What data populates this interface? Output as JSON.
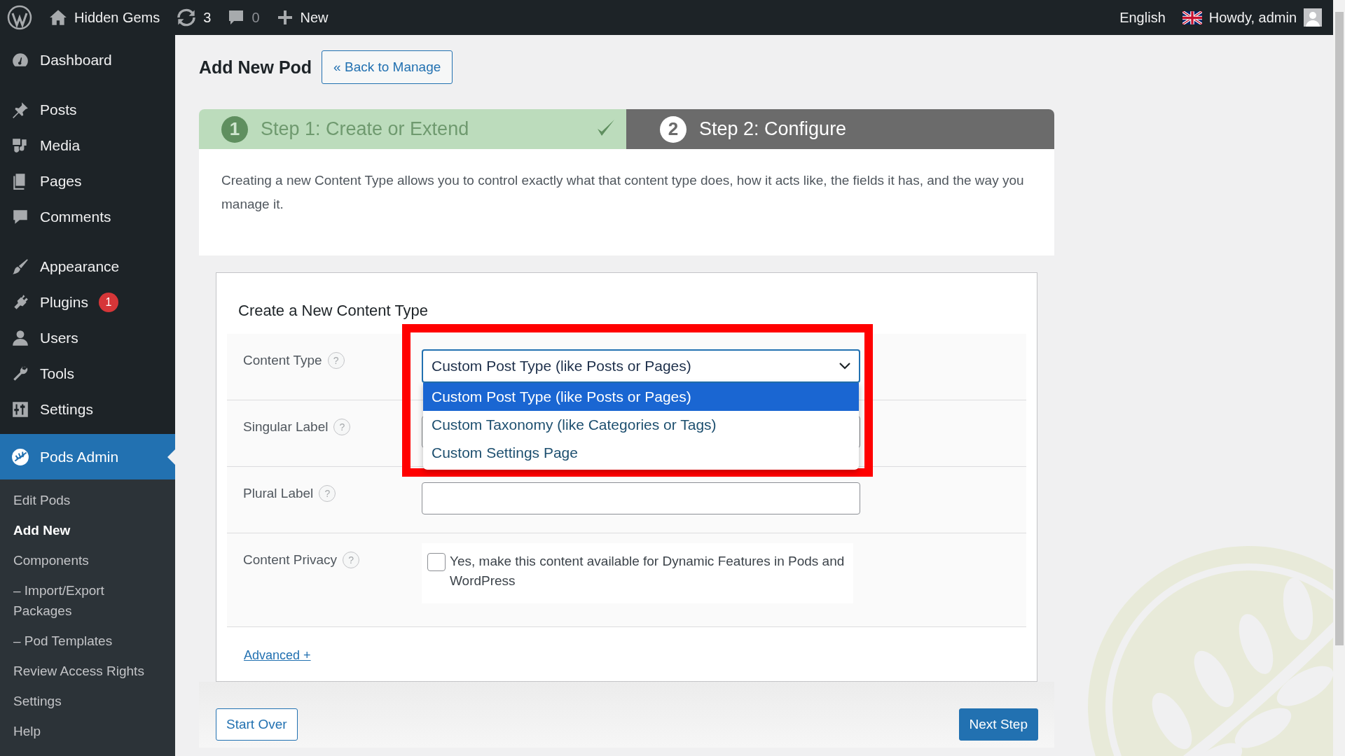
{
  "admin_bar": {
    "site_name": "Hidden Gems",
    "updates_count": "3",
    "comments_count": "0",
    "new_label": "New",
    "language": "English",
    "greeting": "Howdy, admin"
  },
  "sidebar": {
    "groups": [
      [
        {
          "label": "Dashboard",
          "selected": false
        }
      ],
      [
        {
          "label": "Posts",
          "selected": false
        },
        {
          "label": "Media",
          "selected": false
        },
        {
          "label": "Pages",
          "selected": false
        },
        {
          "label": "Comments",
          "selected": false
        }
      ],
      [
        {
          "label": "Appearance",
          "selected": false
        },
        {
          "label": "Plugins",
          "selected": false,
          "badge": "1"
        },
        {
          "label": "Users",
          "selected": false
        },
        {
          "label": "Tools",
          "selected": false
        },
        {
          "label": "Settings",
          "selected": false
        }
      ],
      [
        {
          "label": "Pods Admin",
          "selected": true
        }
      ]
    ],
    "submenu": [
      {
        "label": "Edit Pods",
        "selected": false
      },
      {
        "label": "Add New",
        "selected": true
      },
      {
        "label": "Components",
        "selected": false
      },
      {
        "label": "– Import/Export Packages",
        "selected": false
      },
      {
        "label": "– Pod Templates",
        "selected": false
      },
      {
        "label": "Review Access Rights",
        "selected": false
      },
      {
        "label": "Settings",
        "selected": false
      },
      {
        "label": "Help",
        "selected": false
      }
    ]
  },
  "page": {
    "title": "Add New Pod",
    "back_button": "« Back to Manage"
  },
  "steps": [
    {
      "number": "1",
      "label": "Step 1: Create or Extend",
      "completed": true,
      "selected": false
    },
    {
      "number": "2",
      "label": "Step 2: Configure",
      "completed": false,
      "selected": true
    }
  ],
  "intro": "Creating a new Content Type allows you to control exactly what that content type does, how it acts like, the fields it has, and the way you manage it.",
  "form": {
    "heading": "Create a New Content Type",
    "fields": [
      {
        "kind": "select",
        "label": "Content Type",
        "help": "?",
        "value": "Custom Post Type (like Posts or Pages)",
        "open": true,
        "highlighted": true,
        "options": [
          {
            "label": "Custom Post Type (like Posts or Pages)",
            "selected": true
          },
          {
            "label": "Custom Taxonomy (like Categories or Tags)",
            "selected": false
          },
          {
            "label": "Custom Settings Page",
            "selected": false
          }
        ]
      },
      {
        "kind": "text",
        "label": "Singular Label",
        "help": "?"
      },
      {
        "kind": "text",
        "label": "Plural Label",
        "help": "?"
      },
      {
        "kind": "checkbox",
        "label": "Content Privacy",
        "help": "?",
        "checked": false,
        "text": "Yes, make this content available for Dynamic Features in Pods and WordPress"
      }
    ],
    "advanced_link": "Advanced +"
  },
  "footer": {
    "start_over": "Start Over",
    "next_step": "Next Step"
  }
}
